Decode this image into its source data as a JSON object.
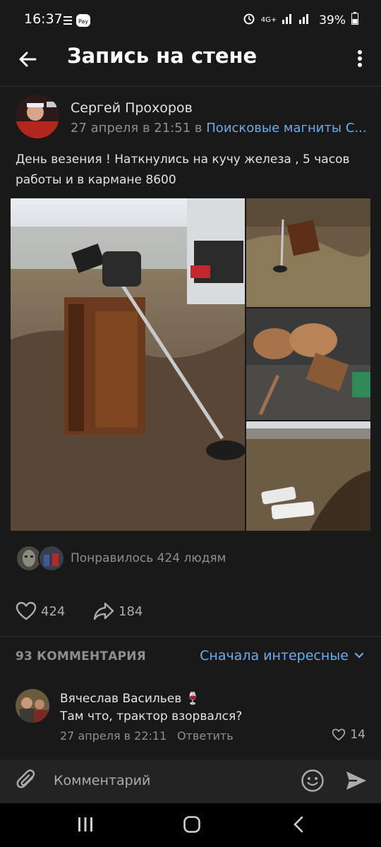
{
  "status_bar": {
    "time": "16:37",
    "battery": "39%",
    "network": "4G+"
  },
  "header": {
    "title": "Запись на стене",
    "back_icon": "arrow-left-icon",
    "more_icon": "more-vertical-icon"
  },
  "post": {
    "author": "Сергей Прохоров",
    "date": "27 апреля в 21:51",
    "in_word": "в",
    "group": "Поисковые магниты С...",
    "text_line1": "День везения ! Наткнулись на кучу железа , 5 часов",
    "text_line2": "работы и в кармане 8600",
    "likes_text": "Понравилось 424 людям",
    "likes_count": "424",
    "reposts_count": "184"
  },
  "comments": {
    "count_label": "93 КОММЕНТАРИЯ",
    "sort_label": "Сначала интересные",
    "items": [
      {
        "name": "Вячеслав Васильев",
        "emoji": "🍷",
        "text": "Там что, трактор взорвался?",
        "date": "27 апреля в 22:11",
        "reply_label": "Ответить",
        "likes": "14"
      }
    ]
  },
  "compose": {
    "placeholder": "Комментарий"
  },
  "colors": {
    "background": "#19191a",
    "accent": "#71aaeb",
    "secondary_text": "#8b8e93"
  }
}
